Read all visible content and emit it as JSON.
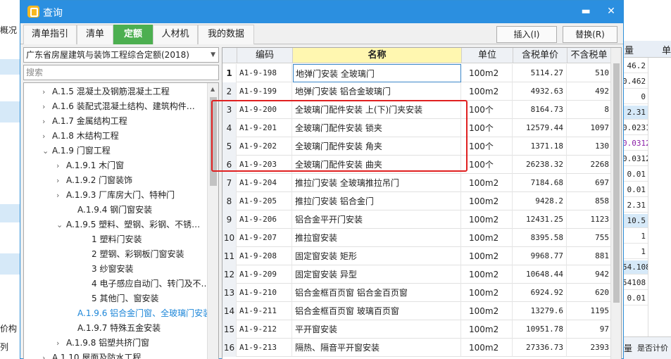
{
  "background": {
    "left_label_top": "概况",
    "left_label_bottom_1": "价构",
    "left_label_bottom_2": "列",
    "right_header_1": "量",
    "right_header_2": "单",
    "right_values": [
      "46.2",
      "0.462",
      "0",
      "2.31",
      "0.0231",
      "0.0312",
      "0.0312",
      "0.01",
      "0.01",
      "2.31",
      "10.5",
      "1",
      "1",
      "54.108",
      "54108",
      "0.01"
    ],
    "right_bottom_1": "量",
    "right_bottom_2": "是否计价"
  },
  "dialog": {
    "title": "查询",
    "minimize": "▬",
    "close": "✕"
  },
  "tabs": [
    {
      "label": "清单指引"
    },
    {
      "label": "清单"
    },
    {
      "label": "定额"
    },
    {
      "label": "人材机"
    },
    {
      "label": "我的数据"
    }
  ],
  "actions": {
    "insert": "插入(I)",
    "replace": "替换(R)"
  },
  "left": {
    "standard": "广东省房屋建筑与装饰工程综合定额(2018)",
    "search_placeholder": "搜索",
    "tree": [
      {
        "toggle": "›",
        "label": "A.1.5 混凝土及钢筋混凝土工程"
      },
      {
        "toggle": "›",
        "label": "A.1.6 装配式混凝土结构、建筑构件…"
      },
      {
        "toggle": "›",
        "label": "A.1.7 金属结构工程"
      },
      {
        "toggle": "›",
        "label": "A.1.8 木结构工程"
      },
      {
        "toggle": "⌄",
        "label": "A.1.9 门窗工程"
      },
      {
        "toggle": "›",
        "label": "A.1.9.1 木门窗"
      },
      {
        "toggle": "›",
        "label": "A.1.9.2 门窗装饰"
      },
      {
        "toggle": "›",
        "label": "A.1.9.3 厂库房大门、特种门"
      },
      {
        "toggle": "",
        "label": "A.1.9.4 钢门窗安装"
      },
      {
        "toggle": "⌄",
        "label": "A.1.9.5 塑料、塑钢、彩钢、不锈…"
      },
      {
        "toggle": "",
        "label": "1 塑料门安装"
      },
      {
        "toggle": "",
        "label": "2 塑钢、彩钢板门窗安装"
      },
      {
        "toggle": "",
        "label": "3 纱窗安装"
      },
      {
        "toggle": "",
        "label": "4 电子感应自动门、转门及不…"
      },
      {
        "toggle": "",
        "label": "5 其他门、窗安装"
      },
      {
        "toggle": "",
        "label": "A.1.9.6 铝合金门窗、全玻璃门安装"
      },
      {
        "toggle": "",
        "label": "A.1.9.7 特殊五金安装"
      },
      {
        "toggle": "›",
        "label": "A.1.9.8 铝塑共挤门窗"
      },
      {
        "toggle": "›",
        "label": "A.1.10 屋面及防水工程"
      }
    ]
  },
  "table": {
    "headers": [
      "",
      "编码",
      "名称",
      "单位",
      "含税单价",
      "不含税单"
    ],
    "rows": [
      {
        "no": "1",
        "code": "A1-9-198",
        "name": "地弹门安装 全玻璃门",
        "unit": "100m2",
        "tax": "5114.27",
        "notax": "510"
      },
      {
        "no": "2",
        "code": "A1-9-199",
        "name": "地弹门安装 铝合金玻璃门",
        "unit": "100m2",
        "tax": "4932.63",
        "notax": "492"
      },
      {
        "no": "3",
        "code": "A1-9-200",
        "name": "全玻璃门配件安装 上(下)门夹安装",
        "unit": "100个",
        "tax": "8164.73",
        "notax": "8"
      },
      {
        "no": "4",
        "code": "A1-9-201",
        "name": "全玻璃门配件安装 锁夹",
        "unit": "100个",
        "tax": "12579.44",
        "notax": "1097"
      },
      {
        "no": "5",
        "code": "A1-9-202",
        "name": "全玻璃门配件安装 角夹",
        "unit": "100个",
        "tax": "1371.18",
        "notax": "130"
      },
      {
        "no": "6",
        "code": "A1-9-203",
        "name": "全玻璃门配件安装 曲夹",
        "unit": "100个",
        "tax": "26238.32",
        "notax": "2268"
      },
      {
        "no": "7",
        "code": "A1-9-204",
        "name": "推拉门安装 全玻璃推拉吊门",
        "unit": "100m2",
        "tax": "7184.68",
        "notax": "697"
      },
      {
        "no": "8",
        "code": "A1-9-205",
        "name": "推拉门安装 铝合金门",
        "unit": "100m2",
        "tax": "9428.2",
        "notax": "858"
      },
      {
        "no": "9",
        "code": "A1-9-206",
        "name": "铝合金平开门安装",
        "unit": "100m2",
        "tax": "12431.25",
        "notax": "1123"
      },
      {
        "no": "10",
        "code": "A1-9-207",
        "name": "推拉窗安装",
        "unit": "100m2",
        "tax": "8395.58",
        "notax": "755"
      },
      {
        "no": "11",
        "code": "A1-9-208",
        "name": "固定窗安装 矩形",
        "unit": "100m2",
        "tax": "9968.77",
        "notax": "881"
      },
      {
        "no": "12",
        "code": "A1-9-209",
        "name": "固定窗安装 异型",
        "unit": "100m2",
        "tax": "10648.44",
        "notax": "942"
      },
      {
        "no": "13",
        "code": "A1-9-210",
        "name": "铝合金框百页窗 铝合金百页窗",
        "unit": "100m2",
        "tax": "6924.92",
        "notax": "620"
      },
      {
        "no": "14",
        "code": "A1-9-211",
        "name": "铝合金框百页窗 玻璃百页窗",
        "unit": "100m2",
        "tax": "13279.6",
        "notax": "1195"
      },
      {
        "no": "15",
        "code": "A1-9-212",
        "name": "平开窗安装",
        "unit": "100m2",
        "tax": "10951.78",
        "notax": "97"
      },
      {
        "no": "16",
        "code": "A1-9-213",
        "name": "隔热、隔音平开窗安装",
        "unit": "100m2",
        "tax": "27336.73",
        "notax": "2393"
      }
    ]
  }
}
